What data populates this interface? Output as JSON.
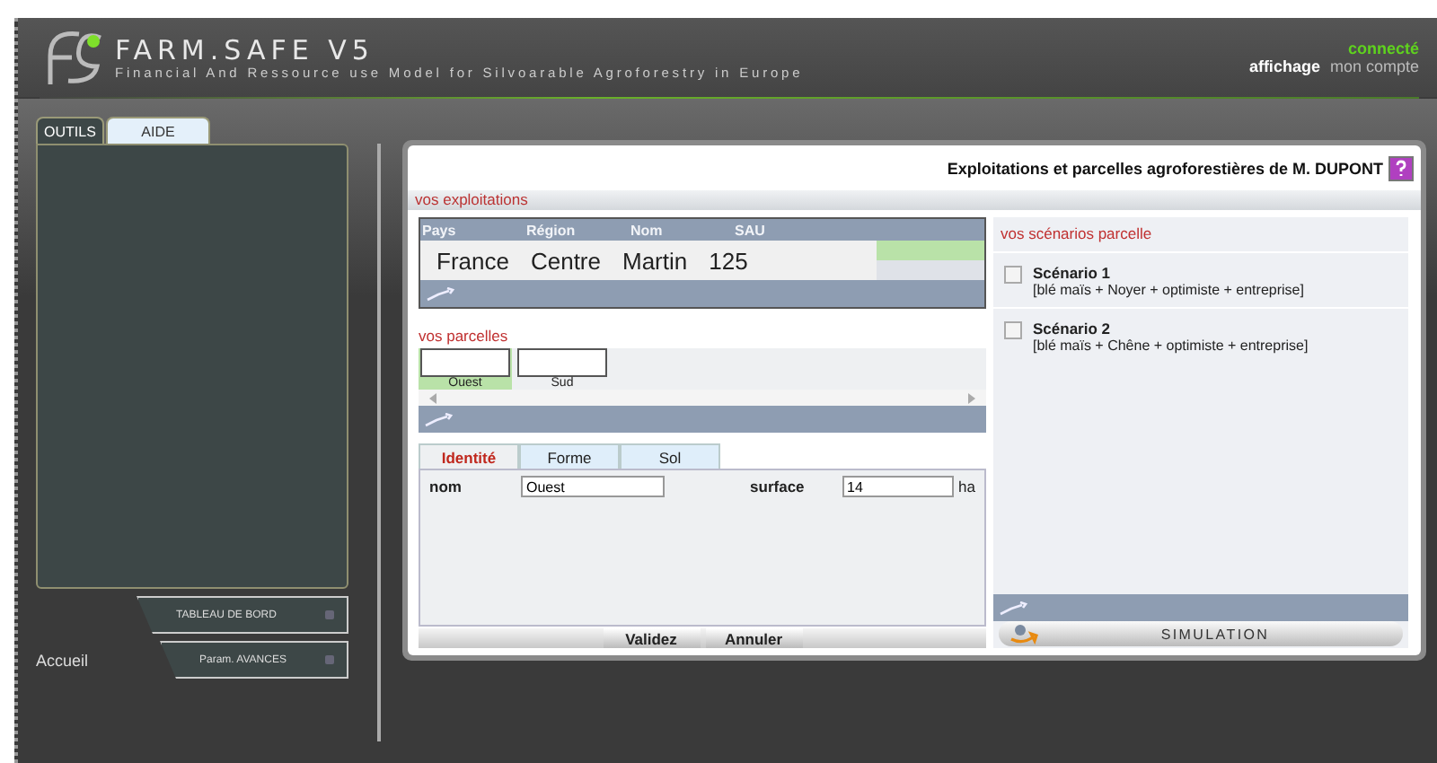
{
  "header": {
    "logo": "FARM.SAFE V5",
    "subtitle": "Financial And Ressource use Model for Silvoarable Agroforestry in Europe",
    "status": "connecté",
    "view_label": "affichage",
    "account_link": "mon compte"
  },
  "side_tabs": [
    {
      "label": "OUTILS",
      "selected": true
    },
    {
      "label": "AIDE",
      "selected": false
    }
  ],
  "side_buttons": [
    "TABLEAU DE BORD",
    "Param. AVANCES"
  ],
  "home_link": "Accueil",
  "window": {
    "title": "Exploitations et parcelles agroforestières de M. DUPONT"
  },
  "farms": {
    "title": "vos exploitations",
    "columns": [
      "Pays",
      "Région",
      "Nom",
      "SAU"
    ],
    "rows": [
      {
        "cells": [
          "France",
          "Centre",
          "Martin",
          "125"
        ],
        "selected": true
      }
    ]
  },
  "plots": {
    "title": "vos parcelles",
    "items": [
      {
        "label": "Ouest",
        "selected": true
      },
      {
        "label": "Sud",
        "selected": false
      }
    ]
  },
  "form_tabs": [
    {
      "label": "Identité",
      "selected": true
    },
    {
      "label": "Forme",
      "selected": false
    },
    {
      "label": "Sol",
      "selected": false
    }
  ],
  "form": {
    "name_label": "nom",
    "name_value": "Ouest",
    "surface_label": "surface",
    "surface_value": "14",
    "unit": "ha"
  },
  "form_buttons": [
    "Validez",
    "Annuler"
  ],
  "scenarios": {
    "title": "vos scénarios parcelle",
    "items": [
      {
        "name": "Scénario 1",
        "detail": "[blé maïs + Noyer + optimiste + entreprise]",
        "checked": false
      },
      {
        "name": "Scénario 2",
        "detail": "[blé maïs + Chêne + optimiste + entreprise]",
        "checked": false
      }
    ]
  },
  "simulation_button": "SIMULATION"
}
